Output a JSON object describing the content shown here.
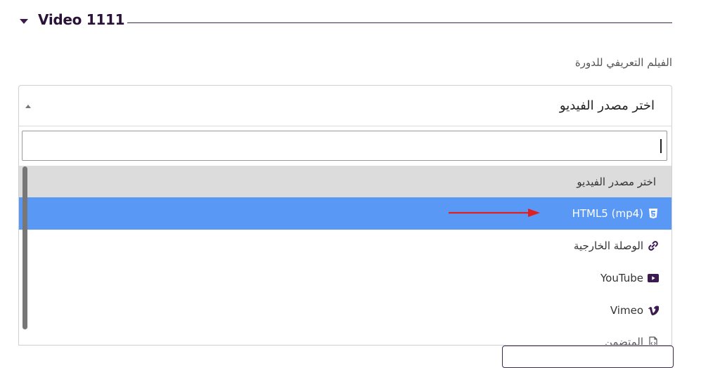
{
  "section": {
    "title": "Video 1111"
  },
  "field": {
    "label": "الفيلم التعريفي للدورة"
  },
  "select": {
    "value": "اختر مصدر الفيديو",
    "search_value": "",
    "options": [
      {
        "label": "اختر مصدر الفيديو",
        "icon": "none"
      },
      {
        "label": "HTML5 (mp4)",
        "icon": "html5-icon"
      },
      {
        "label": "الوصلة الخارجية",
        "icon": "link-icon"
      },
      {
        "label": "YouTube",
        "icon": "youtube-icon"
      },
      {
        "label": "Vimeo",
        "icon": "vimeo-icon"
      },
      {
        "label": "المتضمن",
        "icon": "file-code-icon"
      }
    ],
    "highlighted_index": 1
  },
  "colors": {
    "accent": "#3b1a4f",
    "highlight": "#5a98f6",
    "placeholder_bg": "#dcdcdc",
    "annotation_arrow": "#e02020"
  }
}
